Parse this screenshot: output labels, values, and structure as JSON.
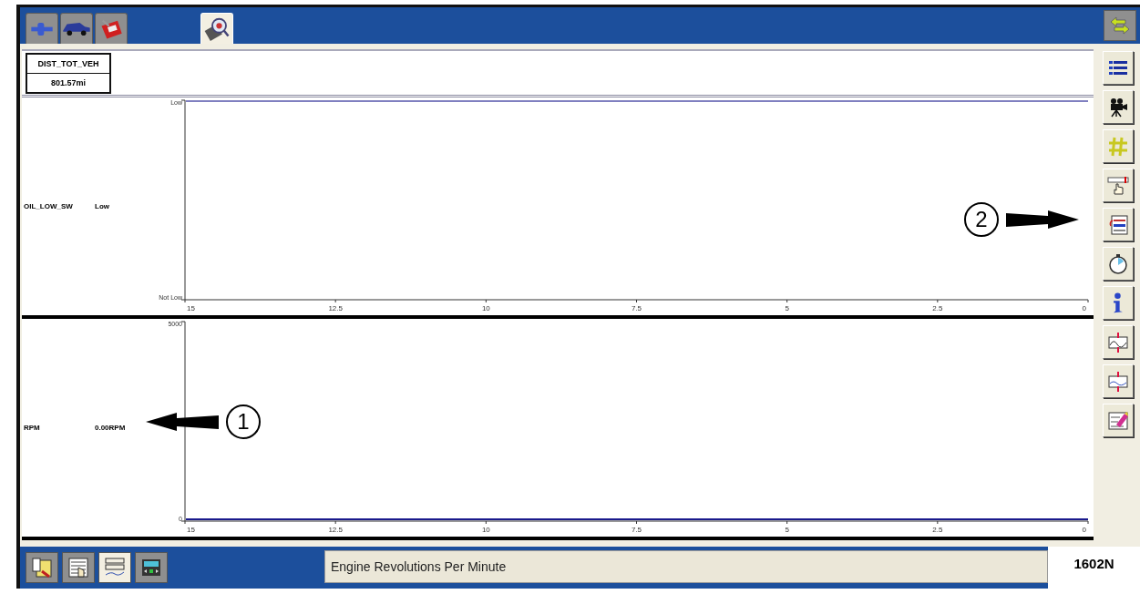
{
  "top_tabs": [
    {
      "kind": "connector",
      "selected": false
    },
    {
      "kind": "vehicle",
      "selected": false
    },
    {
      "kind": "toolbox",
      "selected": false
    },
    {
      "kind": "datalogger",
      "selected": true
    }
  ],
  "header": {
    "pid": {
      "name": "DIST_TOT_VEH",
      "value": "801.57mi"
    }
  },
  "graphs": [
    {
      "name": "OIL_LOW_SW",
      "value": "Low",
      "axis": {
        "y_labels": [
          "Low",
          "Not Low"
        ],
        "x_labels": [
          "15",
          "12.5",
          "10",
          "7.5",
          "5",
          "2.5",
          "0"
        ]
      }
    },
    {
      "name": "RPM",
      "value": "0.00RPM",
      "axis": {
        "y_labels": [
          "5000",
          "0"
        ],
        "x_labels": [
          "15",
          "12.5",
          "10",
          "7.5",
          "5",
          "2.5",
          "0"
        ]
      }
    }
  ],
  "side_toolbar": [
    {
      "kind": "list"
    },
    {
      "kind": "camera"
    },
    {
      "kind": "hash"
    },
    {
      "kind": "cursor"
    },
    {
      "kind": "recall"
    },
    {
      "kind": "stopwatch"
    },
    {
      "kind": "info"
    },
    {
      "kind": "zoom_in"
    },
    {
      "kind": "zoom_out"
    },
    {
      "kind": "eraser"
    }
  ],
  "bottom_tabs": [
    {
      "kind": "report",
      "selected": false
    },
    {
      "kind": "pid_select",
      "selected": false
    },
    {
      "kind": "graph",
      "selected": true
    },
    {
      "kind": "playback",
      "selected": false
    }
  ],
  "status": "Engine Revolutions Per Minute",
  "figure_id": "1602N",
  "callouts": [
    {
      "number": "1"
    },
    {
      "number": "2"
    }
  ]
}
